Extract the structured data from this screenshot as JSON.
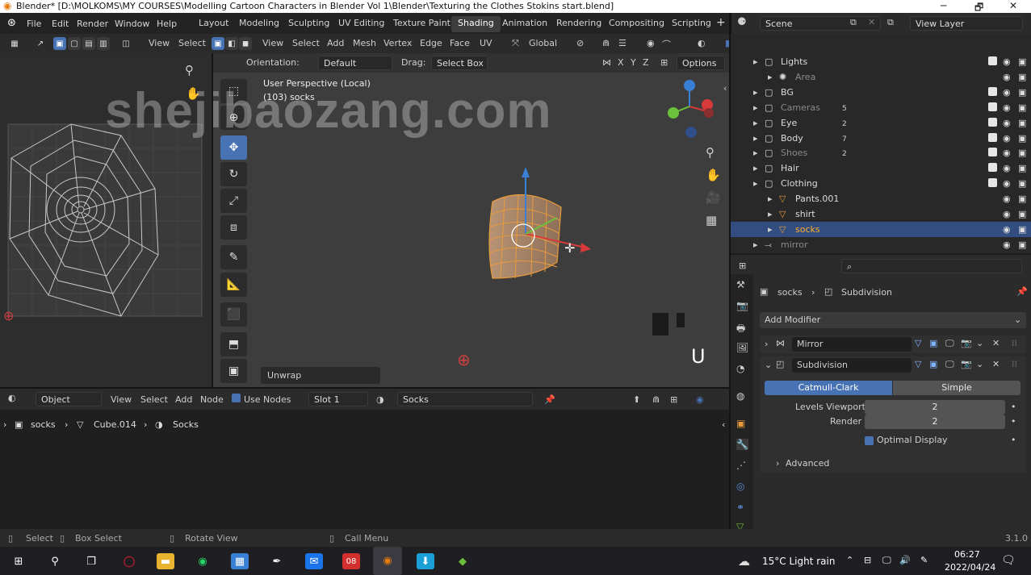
{
  "window": {
    "title": "Blender* [D:\\MOLKOMS\\MY COURSES\\Modelling  Cartoon Characters in Blender Vol 1\\Blender\\Texturing the Clothes Stokins start.blend]",
    "minimize": "─",
    "maximize": "🗗",
    "close": "✕"
  },
  "menu": [
    "File",
    "Edit",
    "Render",
    "Window",
    "Help"
  ],
  "workspaces": [
    "Layout",
    "Modeling",
    "Sculpting",
    "UV Editing",
    "Texture Paint",
    "Shading",
    "Animation",
    "Rendering",
    "Compositing",
    "Scripting"
  ],
  "active_workspace": "Shading",
  "scene": {
    "label": "Scene",
    "view_layer": "View Layer"
  },
  "uv_header": {
    "view": "View",
    "select": "Select"
  },
  "viewport_header": {
    "view": "View",
    "select": "Select",
    "add": "Add",
    "mesh": "Mesh",
    "vertex": "Vertex",
    "edge": "Edge",
    "face": "Face",
    "uv": "UV",
    "transform": "Global"
  },
  "tool_settings": {
    "orientation_label": "Orientation:",
    "orientation_value": "Default",
    "drag_label": "Drag:",
    "drag_value": "Select Box",
    "axes": [
      "X",
      "Y",
      "Z"
    ],
    "options": "Options"
  },
  "viewport": {
    "perspective": "User Perspective (Local)",
    "object_info": "(103) socks",
    "last_op": "Unwrap",
    "keypress": "U"
  },
  "watermark": "shejibaozang.com",
  "node_header": {
    "mode": "Object",
    "view": "View",
    "select": "Select",
    "add": "Add",
    "node": "Node",
    "use_nodes": "Use Nodes",
    "slot": "Slot 1",
    "material": "Socks"
  },
  "breadcrumb": [
    "socks",
    "Cube.014",
    "Socks"
  ],
  "outliner": [
    {
      "name": "Lights",
      "indent": 0,
      "dim": false,
      "selected": false,
      "checked": true
    },
    {
      "name": "Area",
      "indent": 1,
      "dim": true,
      "selected": false,
      "checked": false
    },
    {
      "name": "BG",
      "indent": 0,
      "dim": false,
      "selected": false,
      "checked": true
    },
    {
      "name": "Cameras",
      "indent": 0,
      "dim": true,
      "selected": false,
      "checked": true,
      "badge": "5"
    },
    {
      "name": "Eye",
      "indent": 0,
      "dim": false,
      "selected": false,
      "checked": true,
      "badge": "2"
    },
    {
      "name": "Body",
      "indent": 0,
      "dim": false,
      "selected": false,
      "checked": true,
      "badge": "7"
    },
    {
      "name": "Shoes",
      "indent": 0,
      "dim": true,
      "selected": false,
      "checked": true,
      "badge": "2"
    },
    {
      "name": "Hair",
      "indent": 0,
      "dim": false,
      "selected": false,
      "checked": true
    },
    {
      "name": "Clothing",
      "indent": 0,
      "dim": false,
      "selected": false,
      "checked": true
    },
    {
      "name": "Pants.001",
      "indent": 1,
      "dim": false,
      "selected": false,
      "checked": false
    },
    {
      "name": "shirt",
      "indent": 1,
      "dim": false,
      "selected": false,
      "checked": false
    },
    {
      "name": "socks",
      "indent": 1,
      "dim": false,
      "selected": true,
      "checked": false
    },
    {
      "name": "mirror",
      "indent": 0,
      "dim": true,
      "selected": false,
      "checked": false
    }
  ],
  "properties": {
    "path_object": "socks",
    "path_modifier": "Subdivision",
    "add_modifier": "Add Modifier",
    "mirror_name": "Mirror",
    "subdiv_name": "Subdivision",
    "catmull": "Catmull-Clark",
    "simple": "Simple",
    "levels_label": "Levels Viewport",
    "levels_value": "2",
    "render_label": "Render",
    "render_value": "2",
    "optimal": "Optimal Display",
    "advanced": "Advanced"
  },
  "status": {
    "select": "Select",
    "box_select": "Box Select",
    "rotate": "Rotate View",
    "call_menu": "Call Menu",
    "version": "3.1.0"
  },
  "taskbar": {
    "weather": "15°C  Light rain",
    "time": "06:27",
    "date": "2022/04/24"
  },
  "colors": {
    "accent": "#4772b3",
    "selection": "#334d80",
    "orange": "#e89b3c"
  }
}
